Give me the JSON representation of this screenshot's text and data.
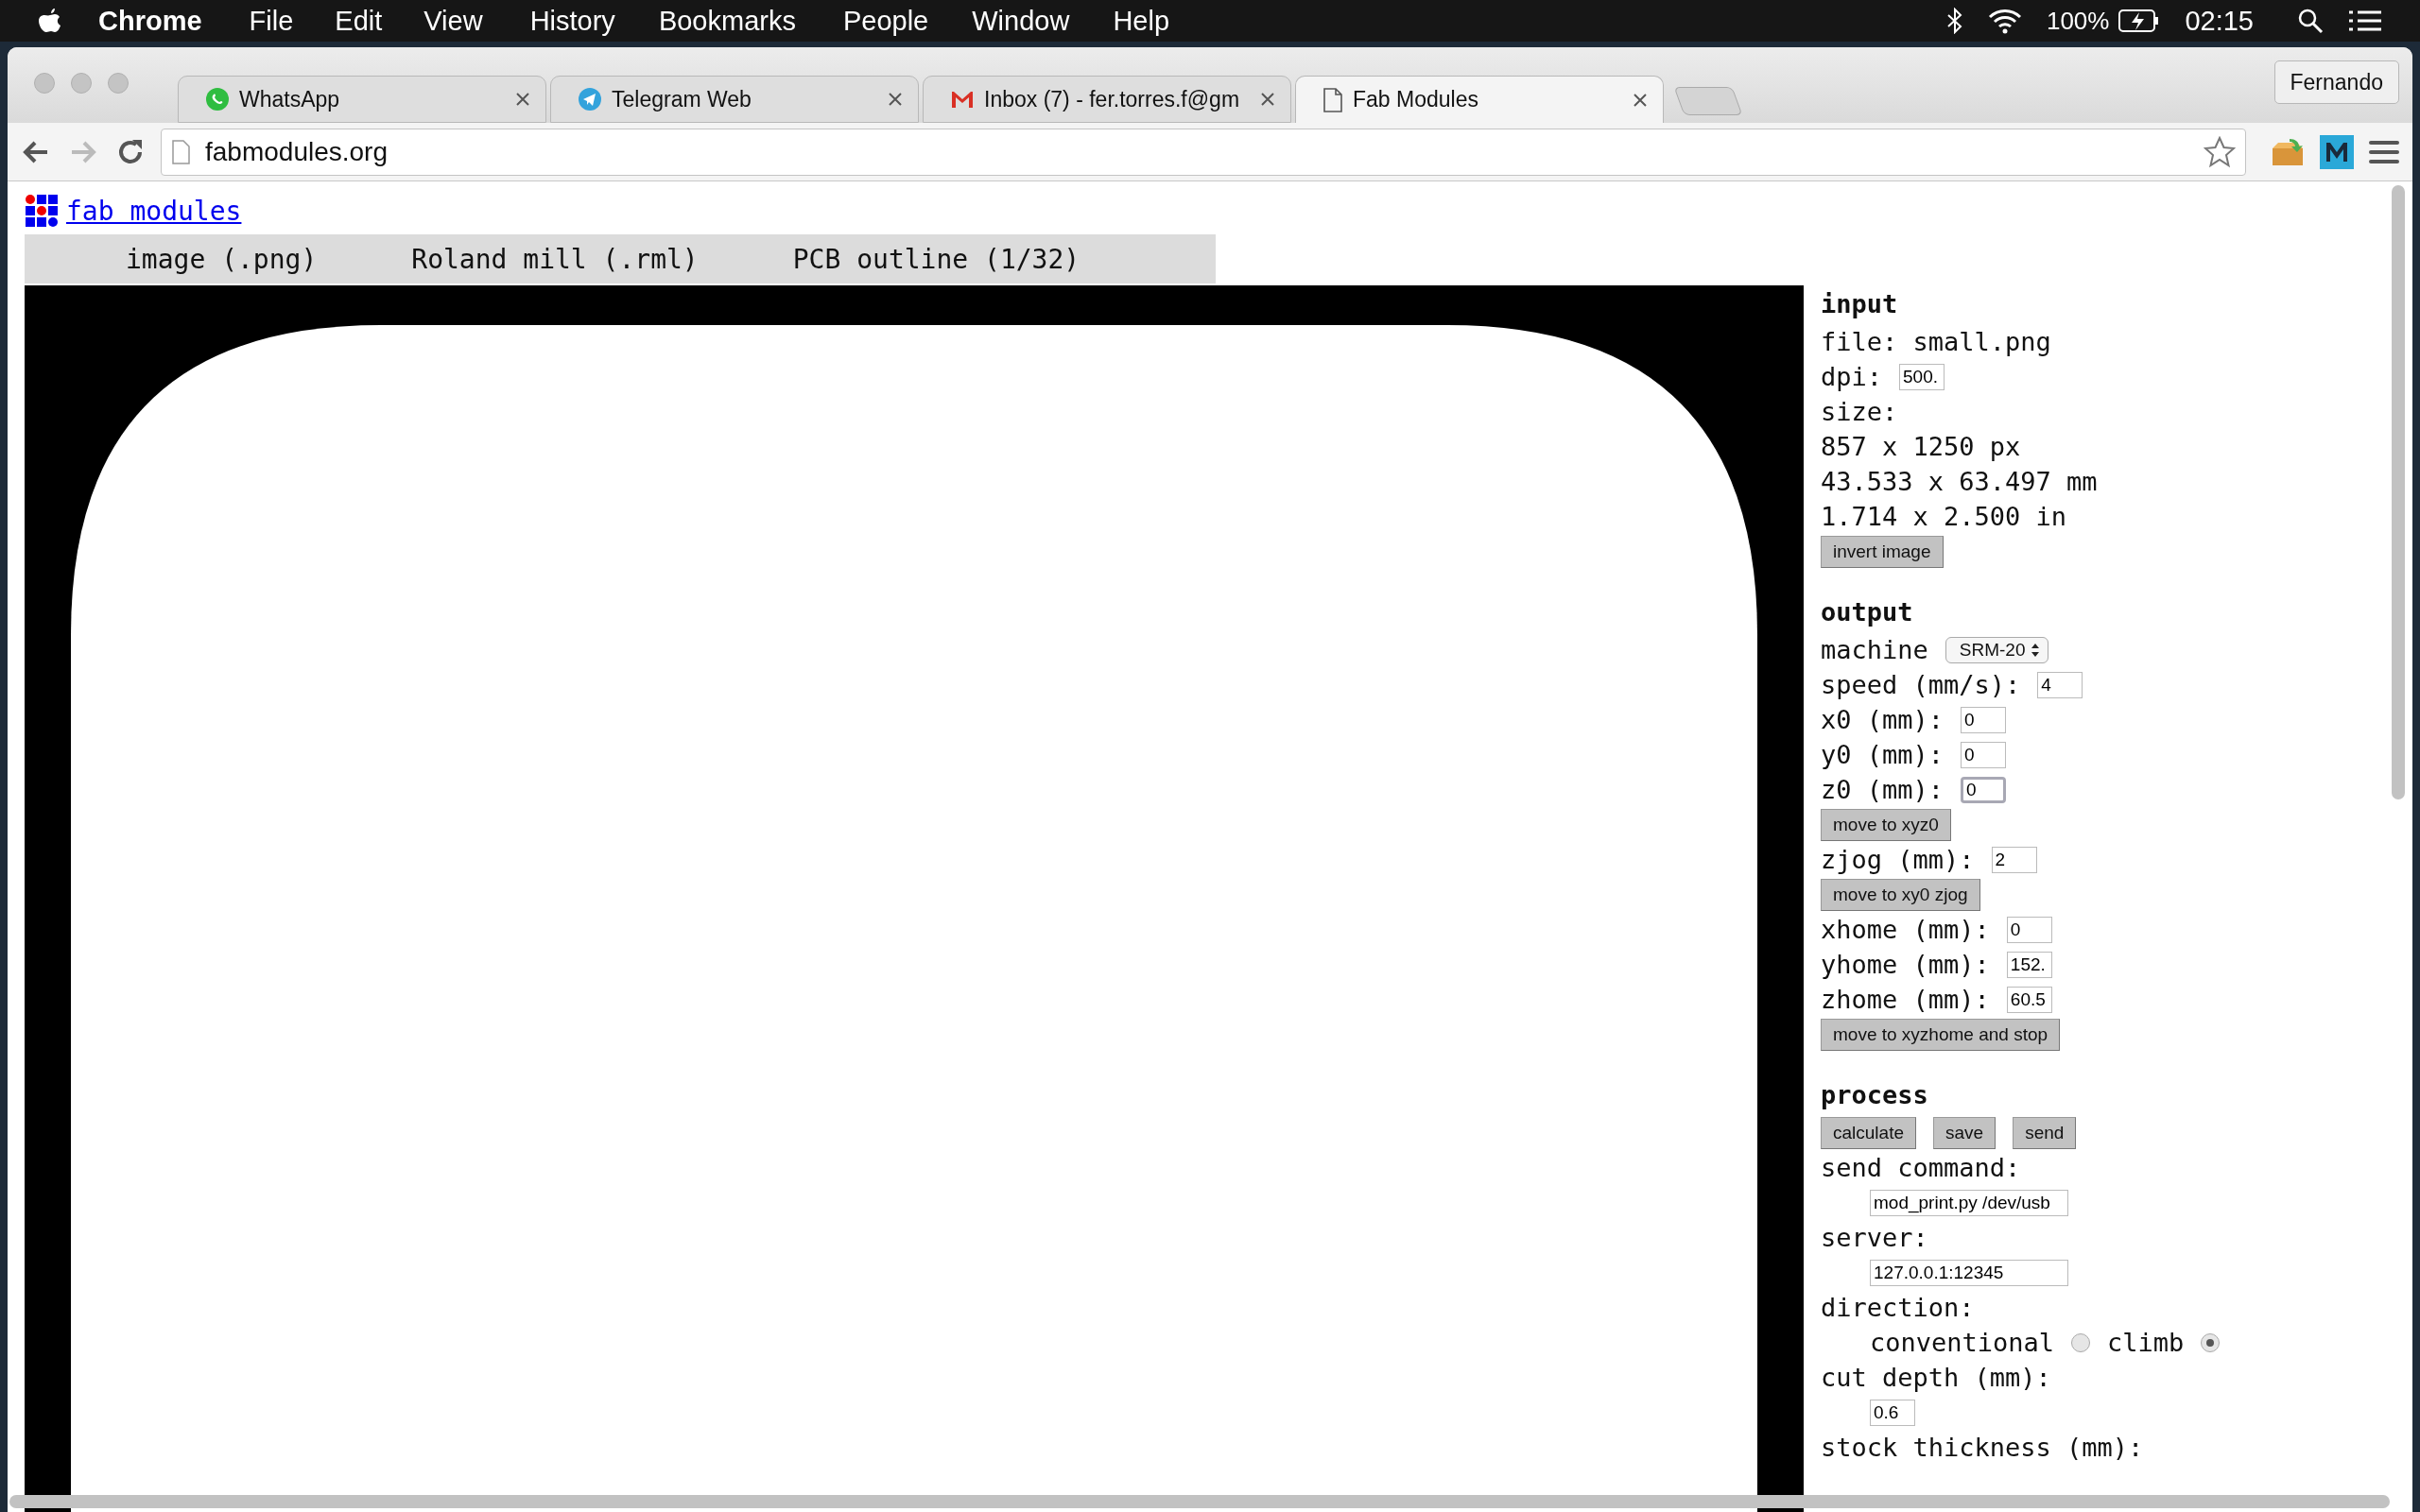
{
  "menu_bar": {
    "app": "Chrome",
    "items": [
      "File",
      "Edit",
      "View",
      "History",
      "Bookmarks",
      "People",
      "Window",
      "Help"
    ],
    "battery": "100%",
    "clock": "02:15"
  },
  "tabs": [
    {
      "title": "WhatsApp",
      "kind": "whatsapp",
      "selected": false
    },
    {
      "title": "Telegram Web",
      "kind": "telegram",
      "selected": false
    },
    {
      "title": "Inbox (7) - fer.torres.f@gm",
      "kind": "mail",
      "selected": false
    },
    {
      "title": "Fab Modules",
      "kind": "page",
      "selected": true
    }
  ],
  "profile": "Fernando",
  "address": "fabmodules.org",
  "page": {
    "logo_link": "fab modules",
    "modules": [
      "image (.png)",
      "Roland mill (.rml)",
      "PCB outline (1/32)"
    ],
    "panel": [
      {
        "kind": "heading",
        "text": "input"
      },
      {
        "kind": "text",
        "text": "file: small.png"
      },
      {
        "kind": "field",
        "label": "dpi:",
        "value": "500.",
        "wide": false,
        "focused": false
      },
      {
        "kind": "text",
        "text": "size:"
      },
      {
        "kind": "text",
        "text": "857 x 1250 px"
      },
      {
        "kind": "text",
        "text": "43.533 x 63.497 mm"
      },
      {
        "kind": "text",
        "text": "1.714 x 2.500 in"
      },
      {
        "kind": "buttons",
        "labels": [
          "invert image"
        ]
      },
      {
        "kind": "heading",
        "text": "output"
      },
      {
        "kind": "select",
        "label": "machine",
        "value": "SRM-20"
      },
      {
        "kind": "field",
        "label": "speed (mm/s):",
        "value": "4",
        "wide": false,
        "focused": false
      },
      {
        "kind": "field",
        "label": "x0 (mm):",
        "value": "0",
        "wide": false,
        "focused": false
      },
      {
        "kind": "field",
        "label": "y0 (mm):",
        "value": "0",
        "wide": false,
        "focused": false
      },
      {
        "kind": "field",
        "label": "z0 (mm):",
        "value": "0",
        "wide": false,
        "focused": true
      },
      {
        "kind": "buttons",
        "labels": [
          "move to xyz0"
        ]
      },
      {
        "kind": "field",
        "label": "zjog (mm):",
        "value": "2",
        "wide": false,
        "focused": false
      },
      {
        "kind": "buttons",
        "labels": [
          "move to xy0 zjog"
        ]
      },
      {
        "kind": "field",
        "label": "xhome (mm):",
        "value": "0",
        "wide": false,
        "focused": false
      },
      {
        "kind": "field",
        "label": "yhome (mm):",
        "value": "152.",
        "wide": false,
        "focused": false
      },
      {
        "kind": "field",
        "label": "zhome (mm):",
        "value": "60.5",
        "wide": false,
        "focused": false
      },
      {
        "kind": "buttons",
        "labels": [
          "move to xyzhome and stop"
        ]
      },
      {
        "kind": "heading",
        "text": "process"
      },
      {
        "kind": "buttons",
        "labels": [
          "calculate",
          "save",
          "send"
        ]
      },
      {
        "kind": "text",
        "text": "send command:"
      },
      {
        "kind": "field",
        "value": "mod_print.py /dev/usb",
        "wide": true,
        "focused": false
      },
      {
        "kind": "text",
        "text": "server:"
      },
      {
        "kind": "field",
        "value": "127.0.0.1:12345",
        "wide": true,
        "focused": false
      },
      {
        "kind": "text",
        "text": "direction:"
      },
      {
        "kind": "radios",
        "options": [
          {
            "label": "conventional",
            "selected": false
          },
          {
            "label": "climb",
            "selected": true
          }
        ]
      },
      {
        "kind": "text",
        "text": "cut depth (mm):"
      },
      {
        "kind": "field",
        "value": "0.6",
        "wide": false,
        "focused": false
      },
      {
        "kind": "text",
        "text": "stock thickness (mm):"
      }
    ]
  }
}
